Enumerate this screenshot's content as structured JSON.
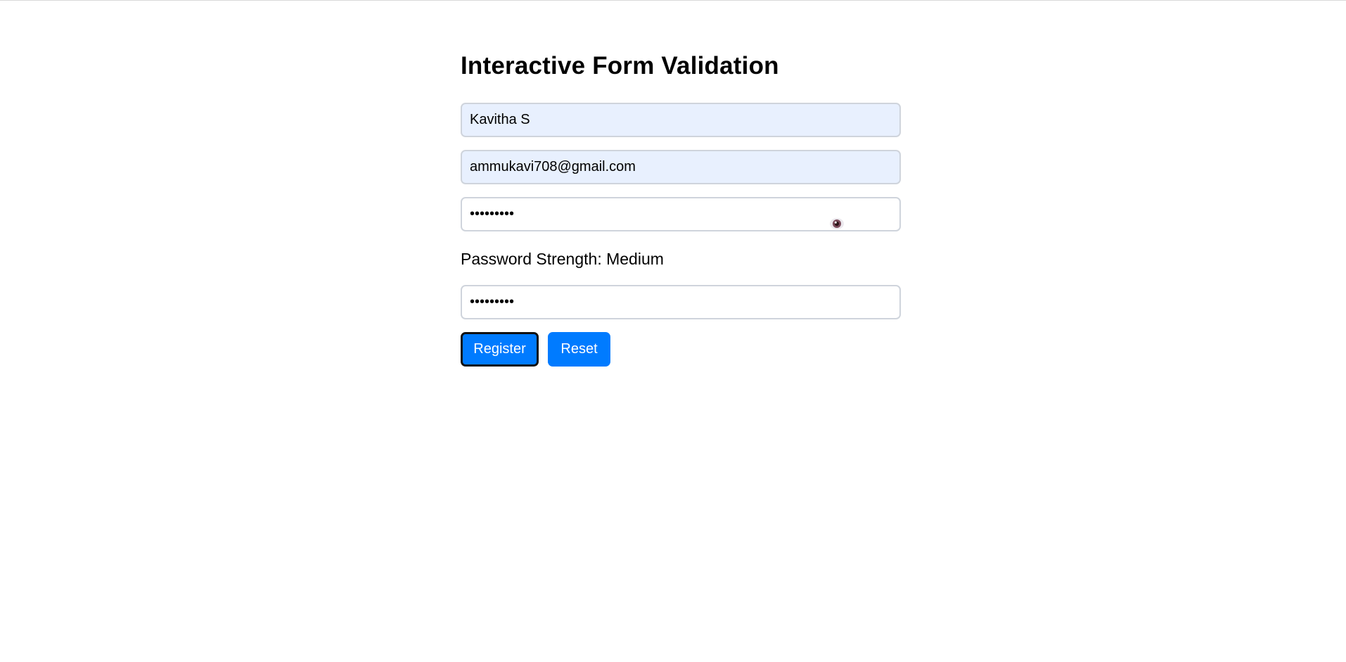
{
  "form": {
    "title": "Interactive Form Validation",
    "name_value": "Kavitha S",
    "email_value": "ammukavi708@gmail.com",
    "password_value": "•••••••••",
    "strength_text": "Password Strength: Medium",
    "confirm_value": "•••••••••",
    "toggle_icon": "eye-icon",
    "register_label": "Register",
    "reset_label": "Reset"
  },
  "colors": {
    "button": "#007bff",
    "autofill_bg": "#e8f0fe",
    "border": "#cfd4dc",
    "focus_ring": "#111111"
  }
}
